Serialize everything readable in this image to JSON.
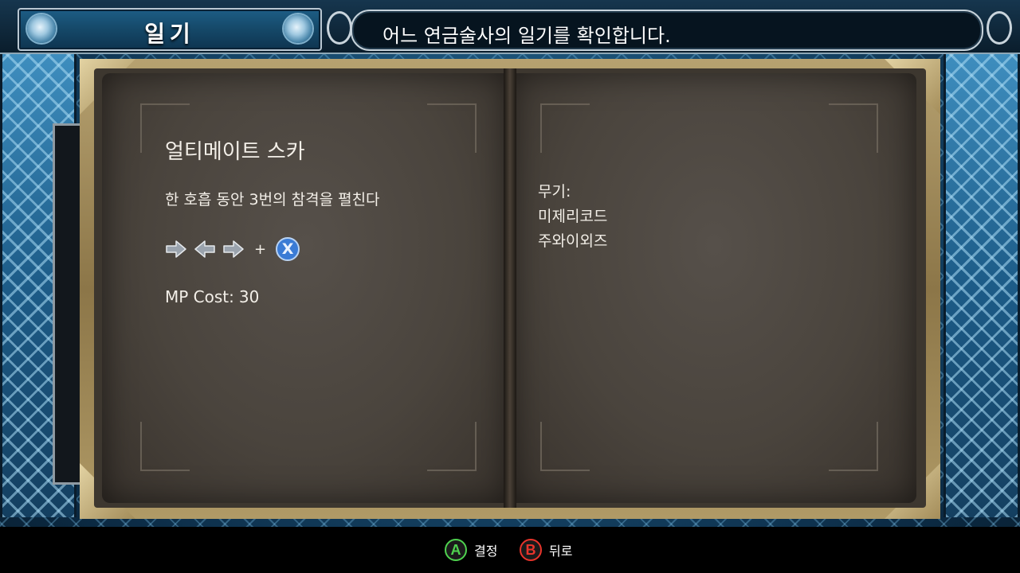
{
  "header": {
    "title": "일기",
    "description": "어느 연금술사의 일기를 확인합니다."
  },
  "left_page": {
    "skill_name": "얼티메이트 스카",
    "skill_desc": "한 호흡 동안 3번의 참격을 펼친다",
    "command": {
      "inputs": [
        "right-arrow-icon",
        "left-arrow-icon",
        "right-arrow-icon"
      ],
      "plus": "+",
      "button": "X"
    },
    "mp_label": "MP Cost:",
    "mp_value": "30"
  },
  "right_page": {
    "weapon_label": "무기:",
    "weapons": [
      "미제리코드",
      "주와이외즈"
    ]
  },
  "footer": {
    "confirm_key": "A",
    "confirm_label": "결정",
    "back_key": "B",
    "back_label": "뒤로"
  },
  "colors": {
    "confirm": "#4fd24f",
    "back": "#e8342b",
    "x_button": "#3a7bd5"
  }
}
